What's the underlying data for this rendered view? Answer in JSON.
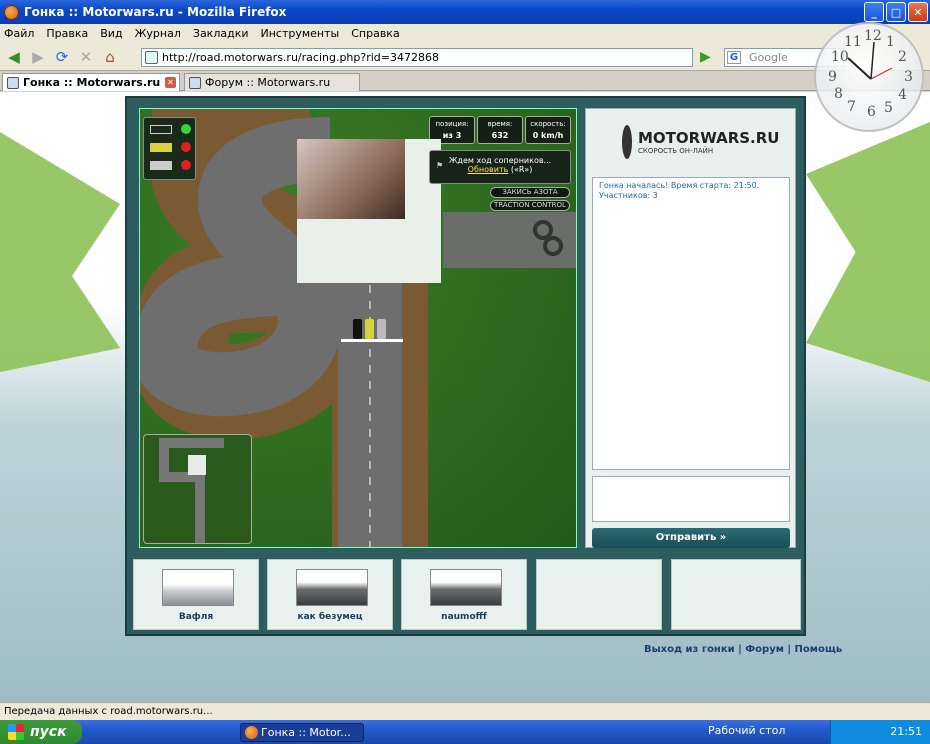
{
  "window": {
    "title": "Гонка :: Motorwars.ru - Mozilla Firefox"
  },
  "menu": [
    "Файл",
    "Правка",
    "Вид",
    "Журнал",
    "Закладки",
    "Инструменты",
    "Справка"
  ],
  "address": {
    "url": "http://road.motorwars.ru/racing.php?rid=3472868"
  },
  "search": {
    "placeholder": "Google",
    "engine": "G"
  },
  "tabs": [
    {
      "label": "Гонка :: Motorwars.ru",
      "active": true
    },
    {
      "label": "Форум :: Motorwars.ru",
      "active": false
    }
  ],
  "clock": {
    "numbers": [
      "12",
      "1",
      "2",
      "3",
      "4",
      "5",
      "6",
      "7",
      "8",
      "9",
      "10",
      "11"
    ]
  },
  "hud": {
    "position_label": "позиция:",
    "position_value": "из 3",
    "time_label": "время:",
    "time_value": "632",
    "speed_label": "скорость:",
    "speed_value": "0 km/h"
  },
  "wait_box": {
    "text": "Ждем ход соперников...",
    "refresh": "Обновить",
    "hint": "(«R»)"
  },
  "buttons": {
    "nitro": "ЗАКИСЬ АЗОТА",
    "traction": "TRACTION CONTROL",
    "send": "Отправить »"
  },
  "logo": {
    "name": "MOTORWARS.RU",
    "tagline": "СКОРОСТЬ ОН-ЛАЙН"
  },
  "chat": {
    "message": "Гонка началась! Время старта: 21:50. Участников: 3"
  },
  "players": [
    {
      "name": "Вафля"
    },
    {
      "name": "как безумец"
    },
    {
      "name": "naumofff"
    }
  ],
  "footer_links": {
    "exit": "Выход из гонки",
    "forum": "Форум",
    "help": "Помощь"
  },
  "status": "Передача данных с road.motorwars.ru...",
  "taskbar": {
    "start": "пуск",
    "task": "Гонка :: Motor...",
    "desktop": "Рабочий стол",
    "time": "21:51"
  },
  "colors": {
    "accent": "#2a6b76",
    "xp_blue": "#2359cc",
    "grass": "#2c6b1e"
  }
}
